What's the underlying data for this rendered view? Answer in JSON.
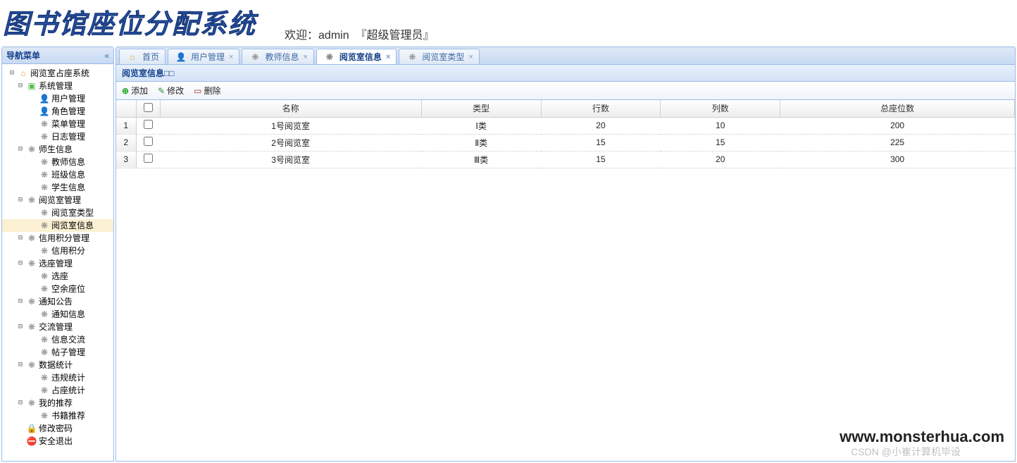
{
  "header": {
    "title": "图书馆座位分配系统",
    "welcome_prefix": "欢迎：",
    "username": "admin",
    "role": "『超级管理员』"
  },
  "sidebar": {
    "title": "导航菜单",
    "root": "阅览室占座系统",
    "groups": [
      {
        "label": "系统管理",
        "icon": "folder",
        "children": [
          {
            "label": "用户管理",
            "icon": "user"
          },
          {
            "label": "角色管理",
            "icon": "user"
          },
          {
            "label": "菜单管理",
            "icon": "gear-y"
          },
          {
            "label": "日志管理",
            "icon": "gear"
          }
        ]
      },
      {
        "label": "师生信息",
        "icon": "gear",
        "children": [
          {
            "label": "教师信息",
            "icon": "gear"
          },
          {
            "label": "班级信息",
            "icon": "gear"
          },
          {
            "label": "学生信息",
            "icon": "gear"
          }
        ]
      },
      {
        "label": "阅览室管理",
        "icon": "gear",
        "children": [
          {
            "label": "阅览室类型",
            "icon": "gear"
          },
          {
            "label": "阅览室信息",
            "icon": "gear",
            "selected": true
          }
        ]
      },
      {
        "label": "信用积分管理",
        "icon": "gear",
        "children": [
          {
            "label": "信用积分",
            "icon": "gear"
          }
        ]
      },
      {
        "label": "选座管理",
        "icon": "gear",
        "children": [
          {
            "label": "选座",
            "icon": "gear"
          },
          {
            "label": "空余座位",
            "icon": "gear"
          }
        ]
      },
      {
        "label": "通知公告",
        "icon": "gear",
        "children": [
          {
            "label": "通知信息",
            "icon": "gear"
          }
        ]
      },
      {
        "label": "交流管理",
        "icon": "gear",
        "children": [
          {
            "label": "信息交流",
            "icon": "gear"
          },
          {
            "label": "帖子管理",
            "icon": "gear"
          }
        ]
      },
      {
        "label": "数据统计",
        "icon": "gear",
        "children": [
          {
            "label": "违规统计",
            "icon": "gear"
          },
          {
            "label": "占座统计",
            "icon": "gear"
          }
        ]
      },
      {
        "label": "我的推荐",
        "icon": "gear",
        "children": [
          {
            "label": "书籍推荐",
            "icon": "gear"
          }
        ]
      }
    ],
    "extra": [
      {
        "label": "修改密码",
        "icon": "lock"
      },
      {
        "label": "安全退出",
        "icon": "exit"
      }
    ]
  },
  "tabs": [
    {
      "label": "首页",
      "icon": "home",
      "closable": false
    },
    {
      "label": "用户管理",
      "icon": "user",
      "closable": true
    },
    {
      "label": "教师信息",
      "icon": "gear",
      "closable": true
    },
    {
      "label": "阅览室信息",
      "icon": "gear",
      "closable": true,
      "active": true
    },
    {
      "label": "阅览室类型",
      "icon": "gear",
      "closable": true
    }
  ],
  "panel": {
    "title": "阅览室信息□□",
    "toolbar": {
      "add": "添加",
      "edit": "修改",
      "del": "删除"
    },
    "columns": [
      "名称",
      "类型",
      "行数",
      "列数",
      "总座位数"
    ],
    "rows": [
      {
        "n": "1号阅览室",
        "t": "Ⅰ类",
        "r": "20",
        "c": "10",
        "s": "200"
      },
      {
        "n": "2号阅览室",
        "t": "Ⅱ类",
        "r": "15",
        "c": "15",
        "s": "225"
      },
      {
        "n": "3号阅览室",
        "t": "Ⅲ类",
        "r": "15",
        "c": "20",
        "s": "300"
      }
    ]
  },
  "watermark": "www.monsterhua.com",
  "watermark2": "CSDN @小崔计算机毕设"
}
